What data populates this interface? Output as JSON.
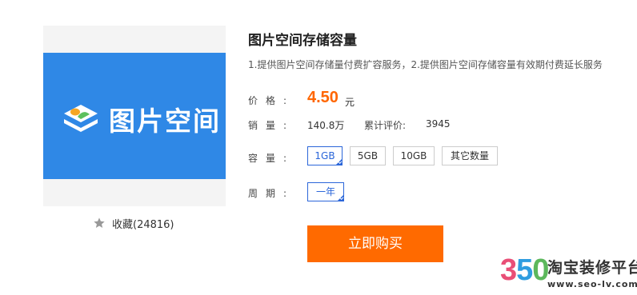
{
  "product": {
    "banner_text": "图片空间",
    "favorite_label": "收藏(24816)",
    "title": "图片空间存储容量",
    "description": "1.提供图片空间存储量付费扩容服务，2.提供图片空间存储容量有效期付费延长服务"
  },
  "price": {
    "label": "价格:",
    "value": "4.50",
    "unit": "元"
  },
  "sales": {
    "label": "销量:",
    "value": "140.8万",
    "reviews_label": "累计评价:",
    "reviews_value": "3945"
  },
  "capacity": {
    "label": "容量:",
    "options": [
      "1GB",
      "5GB",
      "10GB",
      "其它数量"
    ],
    "selected": "1GB"
  },
  "period": {
    "label": "周期:",
    "options": [
      "一年"
    ],
    "selected": "一年"
  },
  "buy_button": "立即购买",
  "watermark": {
    "digits": [
      "3",
      "5",
      "0"
    ],
    "brand": "淘宝装修平台",
    "url": "www.seo-lv.com"
  },
  "colors": {
    "accent": "#ff6600",
    "selected_border": "#2b66d9",
    "banner": "#2f88e6"
  },
  "icons": {
    "favorite": "star-icon",
    "banner_logo": "image-space-logo-icon"
  }
}
